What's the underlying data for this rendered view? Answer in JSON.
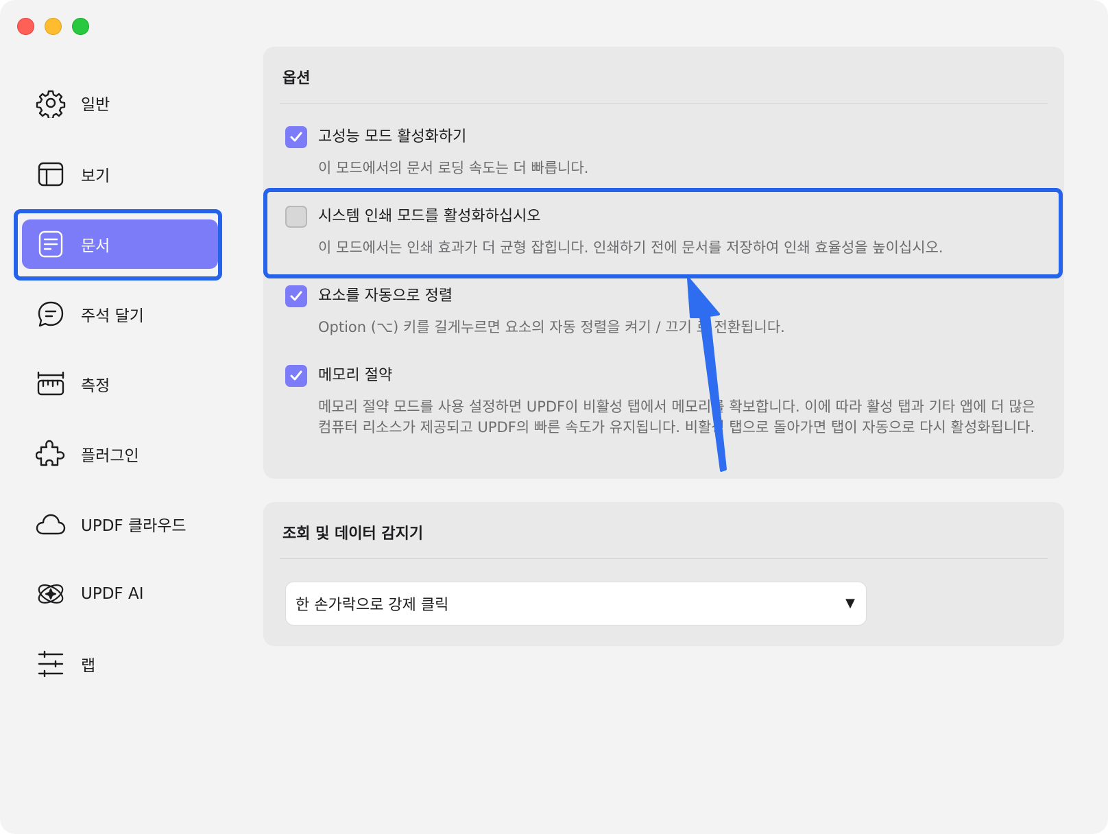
{
  "sidebar": {
    "items": [
      {
        "label": "일반",
        "icon": "gear-icon"
      },
      {
        "label": "보기",
        "icon": "layout-icon"
      },
      {
        "label": "문서",
        "icon": "document-icon"
      },
      {
        "label": "주석 달기",
        "icon": "comment-icon"
      },
      {
        "label": "측정",
        "icon": "ruler-icon"
      },
      {
        "label": "플러그인",
        "icon": "puzzle-icon"
      },
      {
        "label": "UPDF 클라우드",
        "icon": "cloud-icon"
      },
      {
        "label": "UPDF AI",
        "icon": "ai-icon"
      },
      {
        "label": "랩",
        "icon": "sliders-icon"
      }
    ],
    "active_index": 2
  },
  "options_panel": {
    "title": "옵션",
    "options": [
      {
        "title": "고성능 모드 활성화하기",
        "description": "이 모드에서의 문서 로딩 속도는 더 빠릅니다.",
        "checked": true
      },
      {
        "title": "시스템 인쇄 모드를 활성화하십시오",
        "description": "이 모드에서는 인쇄 효과가 더 균형 잡힙니다. 인쇄하기 전에 문서를 저장하여 인쇄 효율성을 높이십시오.",
        "checked": false
      },
      {
        "title": "요소를 자동으로 정렬",
        "description": "Option (⌥) 키를 길게누르면 요소의 자동 정렬을 켜기 / 끄기 로 전환됩니다.",
        "checked": true
      },
      {
        "title": "메모리 절약",
        "description": "메모리 절약 모드를 사용 설정하면 UPDF이 비활성 탭에서 메모리를 확보합니다. 이에 따라 활성 탭과 기타 앱에 더 많은 컴퓨터 리소스가 제공되고 UPDF의 빠른 속도가 유지됩니다. 비활성 탭으로 돌아가면 탭이 자동으로 다시 활성화됩니다.",
        "checked": true
      }
    ]
  },
  "lookup_panel": {
    "title": "조회 및 데이터 감지기",
    "select_value": "한 손가락으로 강제 클릭",
    "caret": "▼"
  },
  "colors": {
    "accent": "#7c7cf8",
    "highlight": "#2563eb",
    "arrow": "#2f6df0"
  }
}
